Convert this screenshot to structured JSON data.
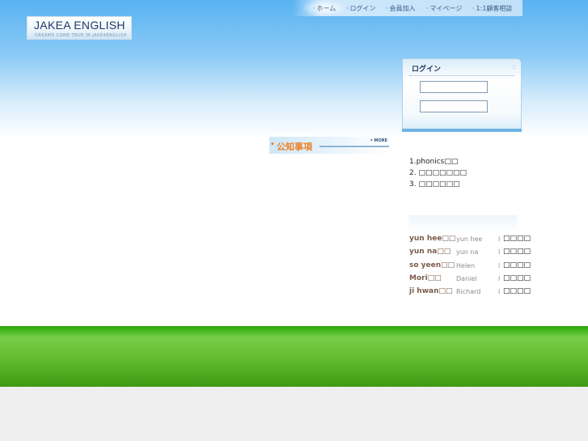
{
  "logo": {
    "title": "JAKEA ENGLISH",
    "subtitle": "DREAMS COME TRUE IN JAKEAENGLISH"
  },
  "nav": {
    "items": [
      {
        "label": "ホーム"
      },
      {
        "label": "ログイン"
      },
      {
        "label": "会員加入"
      },
      {
        "label": "マイページ"
      },
      {
        "label": "1:1顧客相談"
      }
    ]
  },
  "login": {
    "title": "ログイン",
    "corner_mark": "::",
    "id_value": "",
    "password_value": ""
  },
  "notice": {
    "title": "公知事項",
    "more": "• MORE",
    "items": [
      {
        "text": "1.phonics□□"
      },
      {
        "text": "2. □□□□□□□"
      },
      {
        "text": "3. □□□□□□"
      }
    ]
  },
  "teachers": [
    {
      "name": "yun hee□□",
      "sub": "yun hee",
      "action": "□□□□"
    },
    {
      "name": "yun na□□",
      "sub": "yun na",
      "action": "□□□□"
    },
    {
      "name": "so yeen□□",
      "sub": "Helen",
      "action": "□□□□"
    },
    {
      "name": "Mori□□",
      "sub": "Daniel",
      "action": "□□□□"
    },
    {
      "name": "ji hwan□□",
      "sub": "Richard",
      "action": "□□□□"
    }
  ],
  "colors": {
    "sky_top": "#59b2f1",
    "grass": "#3ab317",
    "notice_accent": "#f08024",
    "footer": "#efefef"
  }
}
